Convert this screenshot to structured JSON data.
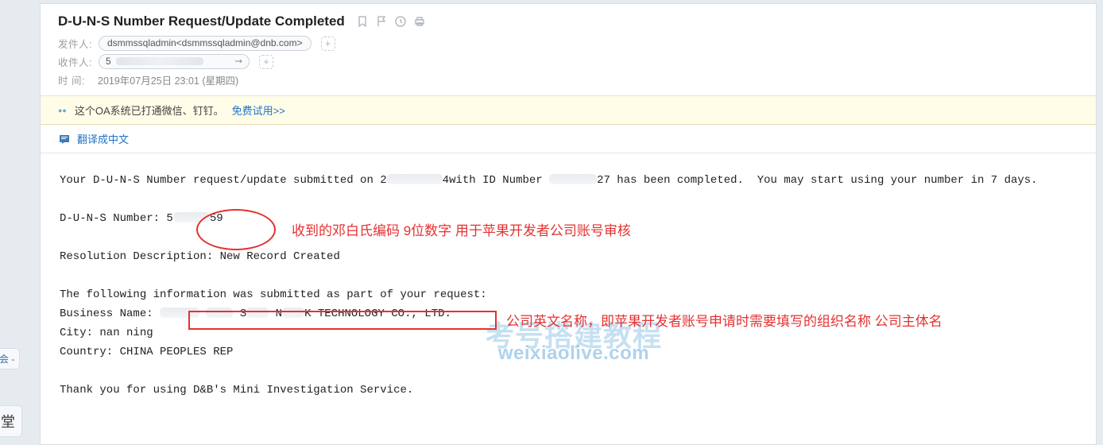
{
  "left": {
    "bubble1": "会 -",
    "bubble2": "堂"
  },
  "header": {
    "subject": "D-U-N-S Number Request/Update Completed",
    "icons": [
      "bookmark-icon",
      "flag-icon",
      "clock-icon",
      "print-icon"
    ]
  },
  "meta": {
    "from_label": "发件人:",
    "from_value": "dsmmssqladmin<dsmmssqladmin@dnb.com>",
    "to_label": "收件人:",
    "to_prefix": "5",
    "time_label": "时 间:",
    "time_value": "2019年07月25日 23:01 (星期四)"
  },
  "banner": {
    "text": "这个OA系统已打通微信、钉钉。",
    "link": "免费试用>>"
  },
  "translate": {
    "label": "翻译成中文"
  },
  "body": {
    "p1_pre": "Your D-U-N-S Number request/update submitted on 2",
    "p1_mid": "4with ID Number ",
    "p1_post": "27 has been completed.  You may start using your number in 7 days.",
    "duns_label": "D-U-N-S Number: 5",
    "duns_tail": "59",
    "resolution": "Resolution Description: New Record Created",
    "following": "The following information was submitted as part of your request:",
    "biz_label": "Business Name: ",
    "biz_mid_a": "S",
    "biz_mid_b": "N",
    "biz_mid_c": "K TECHNOLOGY CO., LTD.",
    "city": "City: nan ning",
    "country": "Country: CHINA PEOPLES REP",
    "thanks": "Thank you for using D&B's Mini Investigation Service."
  },
  "annotations": {
    "a1": "收到的邓白氏编码 9位数字   用于苹果开发者公司账号审核",
    "a2": "公司英文名称，即苹果开发者账号申请时需要填写的组织名称 公司主体名"
  },
  "watermark": {
    "cn": "考号搭建教程",
    "en": "weixiaolive.com"
  }
}
